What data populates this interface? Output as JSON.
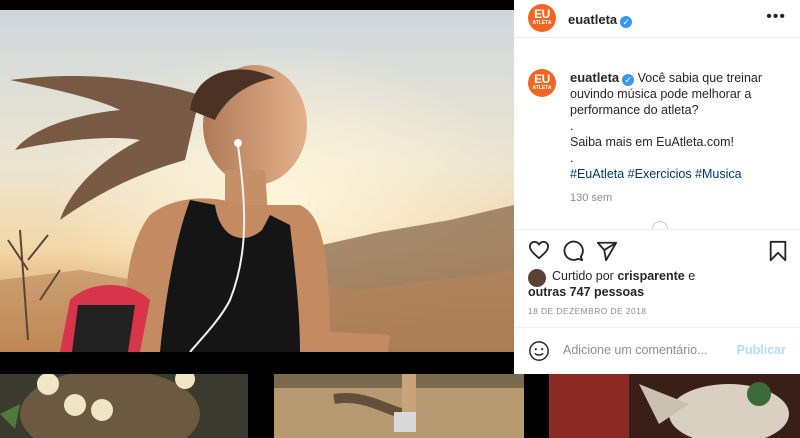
{
  "post": {
    "username": "euatleta",
    "verified_mark": "✓",
    "logo_text_top": "EU",
    "logo_text_bottom": "ATLETA",
    "more_label": "•••",
    "caption_line1": "Você sabia que treinar ouvindo música pode melhorar a performance do atleta?",
    "caption_dot1": ".",
    "caption_line2": "Saiba mais em EuAtleta.com!",
    "caption_dot2": ".",
    "hashtags": "#EuAtleta #Exercicios #Musica",
    "time_ago": "130 sem",
    "liked_prefix": "Curtido por",
    "liked_user": "crisparente",
    "liked_and": "e",
    "liked_others": "outras 747 pessoas",
    "date": "18 DE DEZEMBRO DE 2018",
    "comment_placeholder": "Adicione um comentário...",
    "publish_label": "Publicar"
  },
  "colors": {
    "brand": "#f26522",
    "verified": "#3897f0",
    "link": "#00376b",
    "publish_disabled": "#b3dbff"
  },
  "icons": [
    "heart-icon",
    "comment-icon",
    "share-icon",
    "bookmark-icon",
    "emoji-icon",
    "more-options-icon",
    "verified-badge-icon"
  ]
}
